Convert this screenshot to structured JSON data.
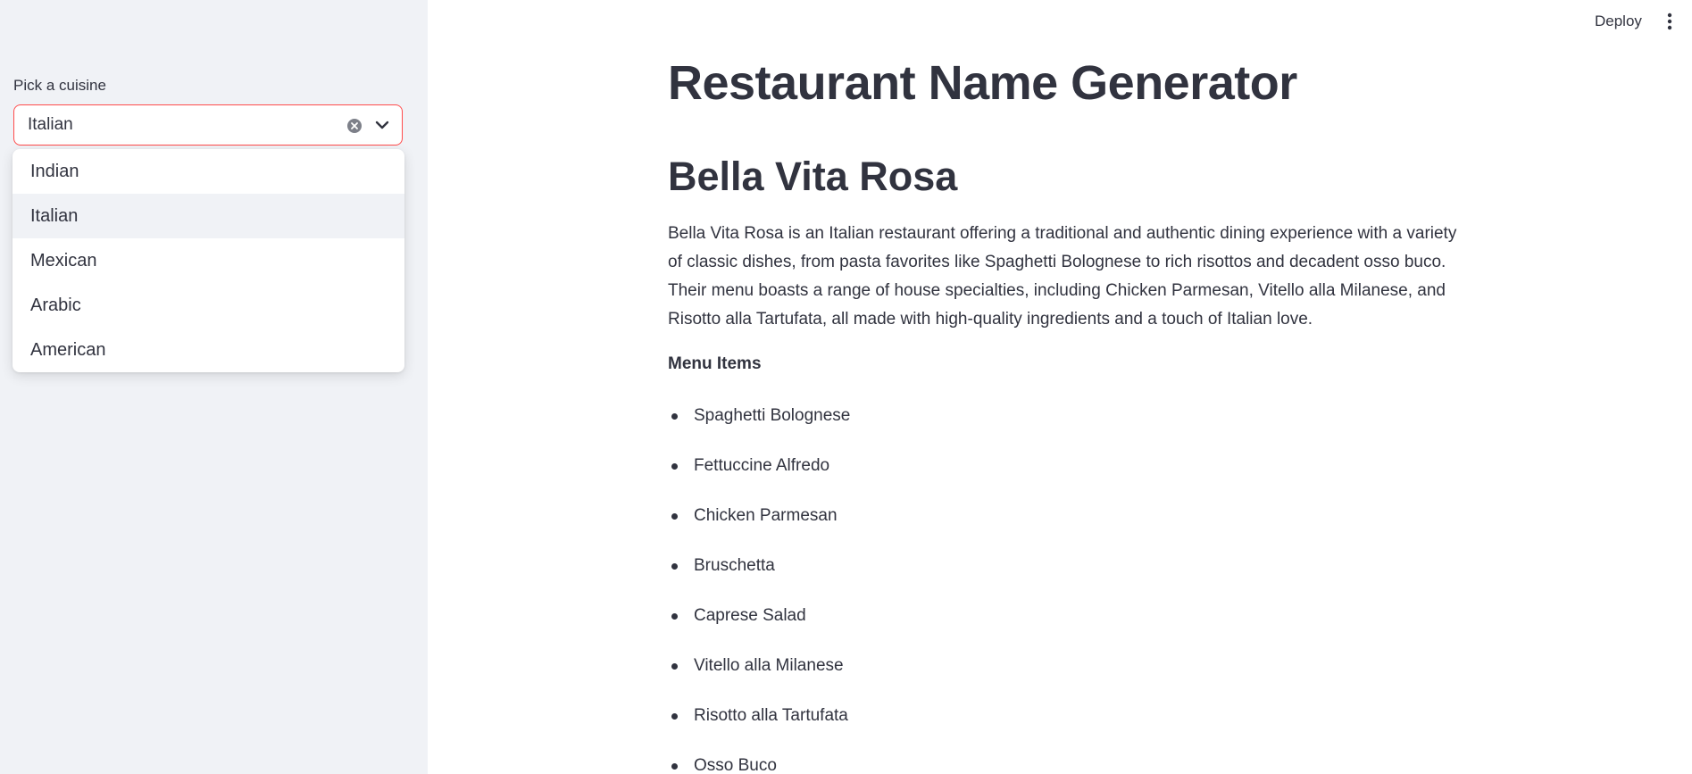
{
  "header": {
    "deploy_label": "Deploy",
    "menu_icon": "kebab-menu-icon"
  },
  "sidebar": {
    "select": {
      "label": "Pick a cuisine",
      "value": "Italian",
      "clear_icon": "clear-circle-icon",
      "toggle_icon": "chevron-down-icon",
      "options": [
        "Indian",
        "Italian",
        "Mexican",
        "Arabic",
        "American"
      ],
      "selected_option": "Italian"
    }
  },
  "main": {
    "title": "Restaurant Name Generator",
    "restaurant_name": "Bella Vita Rosa",
    "description": "Bella Vita Rosa is an Italian restaurant offering a traditional and authentic dining experience with a variety of classic dishes, from pasta favorites like Spaghetti Bolognese to rich risottos and decadent osso buco. Their menu boasts a range of house specialties, including Chicken Parmesan, Vitello alla Milanese, and Risotto alla Tartufata, all made with high-quality ingredients and a touch of Italian love.",
    "menu_heading": "Menu Items",
    "menu_items": [
      "Spaghetti Bolognese",
      "Fettuccine Alfredo",
      "Chicken Parmesan",
      "Bruschetta",
      "Caprese Salad",
      "Vitello alla Milanese",
      "Risotto alla Tartufata",
      "Osso Buco"
    ]
  },
  "colors": {
    "accent": "#ff4b4b",
    "sidebar_bg": "#f0f2f6",
    "text": "#31333f"
  }
}
